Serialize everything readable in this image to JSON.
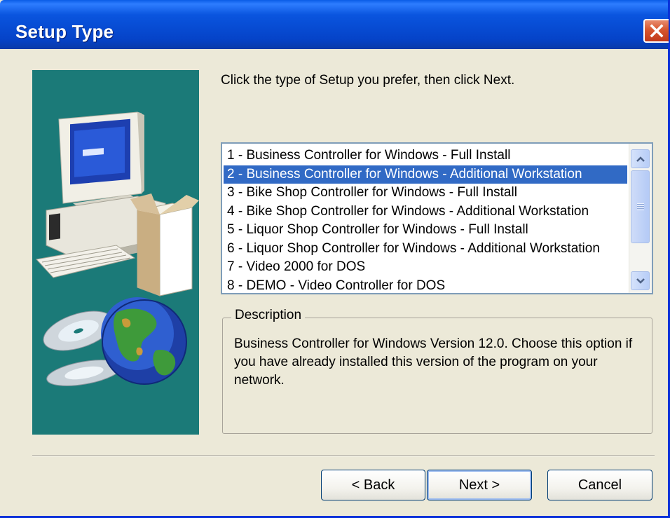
{
  "window": {
    "title": "Setup Type"
  },
  "prompt": "Click the type of Setup you prefer, then click Next.",
  "setup_list": {
    "selected_index": 1,
    "items": [
      "1 - Business Controller for Windows - Full Install",
      "2 - Business Controller for Windows - Additional Workstation",
      "3 - Bike Shop Controller for Windows - Full Install",
      "4 - Bike Shop Controller for Windows - Additional Workstation",
      "5 - Liquor Shop Controller for Windows - Full Install",
      "6 - Liquor Shop Controller for Windows - Additional Workstation",
      "7 - Video 2000 for DOS",
      "8 - DEMO - Video Controller for DOS"
    ]
  },
  "description": {
    "legend": "Description",
    "text": "Business Controller for Windows Version 12.0.  Choose this option if you have already installed this version of the program on your network."
  },
  "buttons": {
    "back": "< Back",
    "next": "Next >",
    "cancel": "Cancel"
  },
  "colors": {
    "title_bar": "#0a55df",
    "side_panel": "#1b7a78",
    "selection": "#316ac5",
    "close_button": "#d7562f"
  },
  "icons": [
    "close-icon",
    "computer-illustration",
    "cd-discs-illustration",
    "globe-illustration",
    "scroll-up-icon",
    "scroll-down-icon"
  ]
}
